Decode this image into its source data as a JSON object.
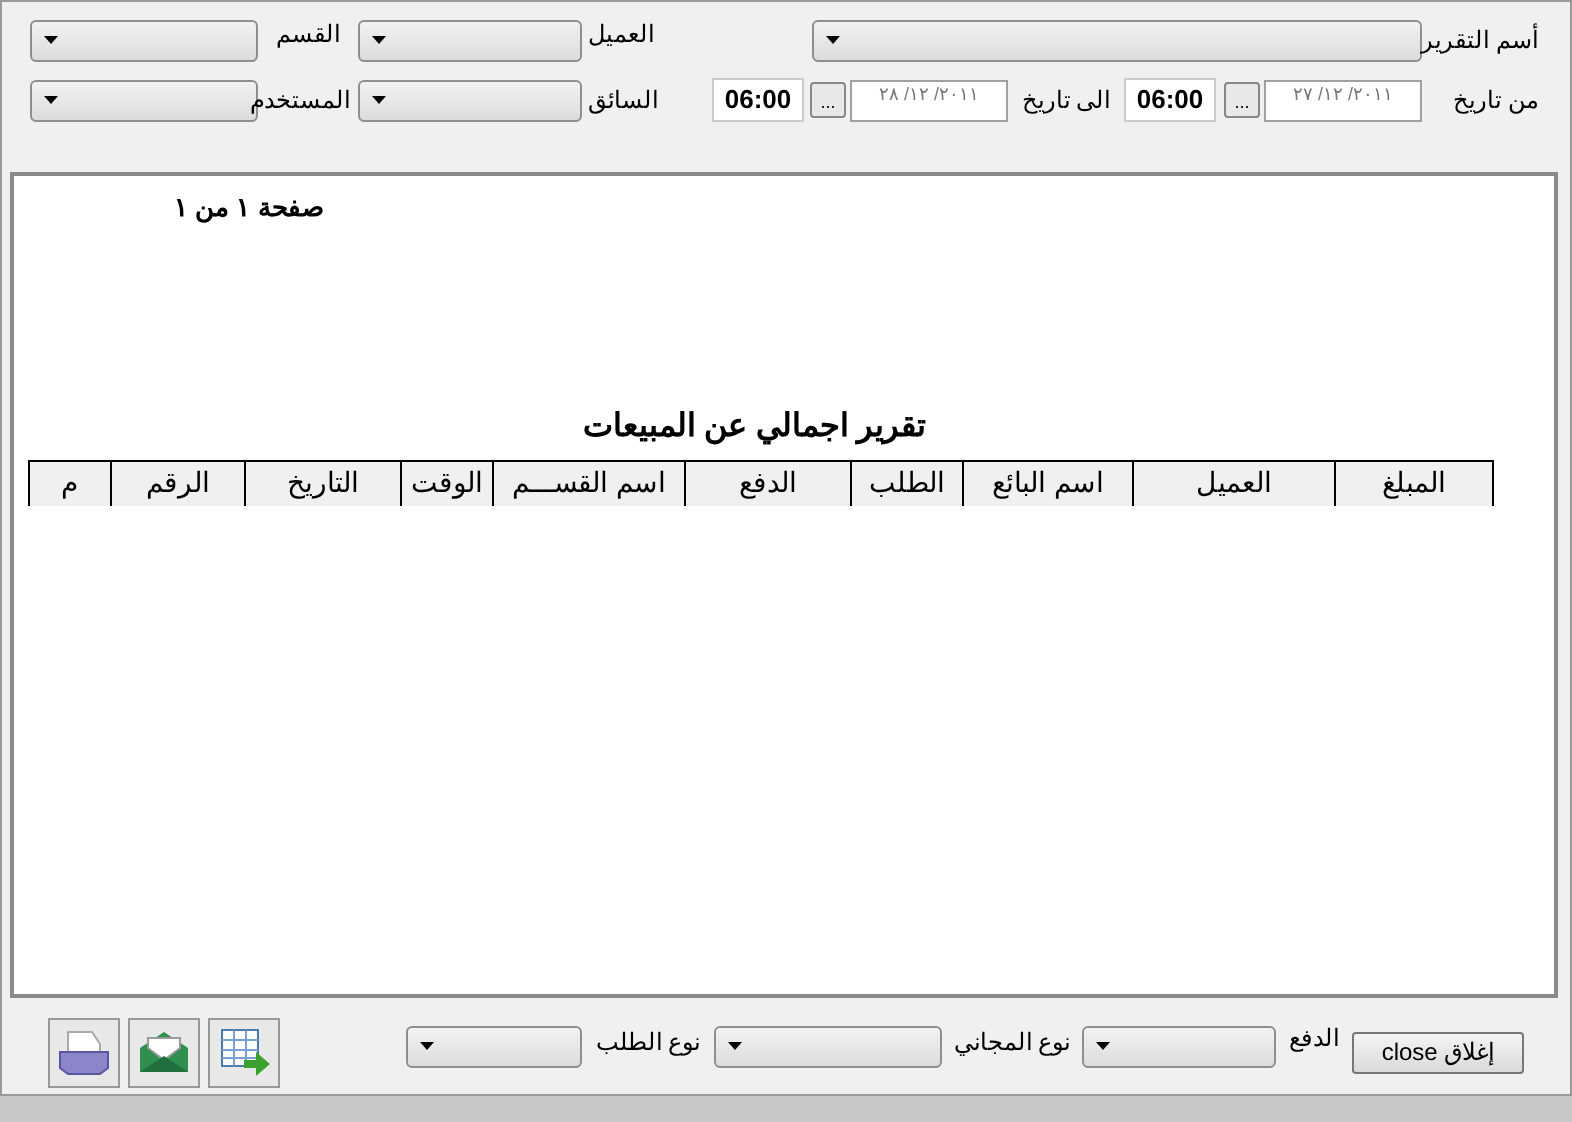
{
  "filters": {
    "report_name_label": "أسم التقرير",
    "customer_label": "العميل",
    "section_label": "القسم",
    "driver_label": "السائق",
    "user_label": "المستخدم",
    "from_label": "من تاريخ",
    "from_date": "٢٠١١/ ١٢/ ٢٧",
    "from_time": "06:00",
    "to_label": "الى تاريخ",
    "to_date": "٢٠١١/ ١٢/ ٢٨",
    "to_time": "06:00",
    "picker_button": "..."
  },
  "report": {
    "page_info": "صفحة ١ من ١",
    "title": "تقرير اجمالي عن المبيعات",
    "columns": [
      "المبلغ",
      "العميل",
      "اسم البائع",
      "الطلب",
      "الدفع",
      "اسم القســـم",
      "الوقت",
      "التاريخ",
      "الرقم",
      "م"
    ]
  },
  "footer": {
    "close_button": "إغلاق close",
    "payment_label": "الدفع",
    "free_type_label": "نوع المجاني",
    "order_type_label": "نوع الطلب"
  }
}
